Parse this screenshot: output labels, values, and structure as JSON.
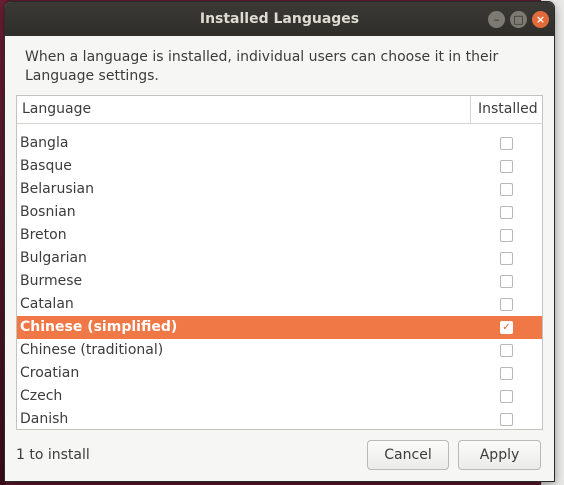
{
  "window": {
    "title": "Installed Languages",
    "controls": [
      "minimize",
      "maximize",
      "close"
    ]
  },
  "description": "When a language is installed, individual users can choose it in their Language settings.",
  "table": {
    "headers": {
      "language": "Language",
      "installed": "Installed"
    },
    "rows": [
      {
        "name": "Bangla",
        "installed": false,
        "selected": false
      },
      {
        "name": "Basque",
        "installed": false,
        "selected": false
      },
      {
        "name": "Belarusian",
        "installed": false,
        "selected": false
      },
      {
        "name": "Bosnian",
        "installed": false,
        "selected": false
      },
      {
        "name": "Breton",
        "installed": false,
        "selected": false
      },
      {
        "name": "Bulgarian",
        "installed": false,
        "selected": false
      },
      {
        "name": "Burmese",
        "installed": false,
        "selected": false
      },
      {
        "name": "Catalan",
        "installed": false,
        "selected": false
      },
      {
        "name": "Chinese (simplified)",
        "installed": true,
        "selected": true
      },
      {
        "name": "Chinese (traditional)",
        "installed": false,
        "selected": false
      },
      {
        "name": "Croatian",
        "installed": false,
        "selected": false
      },
      {
        "name": "Czech",
        "installed": false,
        "selected": false
      },
      {
        "name": "Danish",
        "installed": false,
        "selected": false
      }
    ]
  },
  "status": "1 to install",
  "buttons": {
    "cancel": "Cancel",
    "apply": "Apply"
  },
  "colors": {
    "selection": "#f07746",
    "titlebar": "#2f2e2b",
    "close": "#e06a3a"
  },
  "icons": {
    "checkmark": "✓",
    "minimize": "–",
    "maximize": "□",
    "close": "×"
  }
}
